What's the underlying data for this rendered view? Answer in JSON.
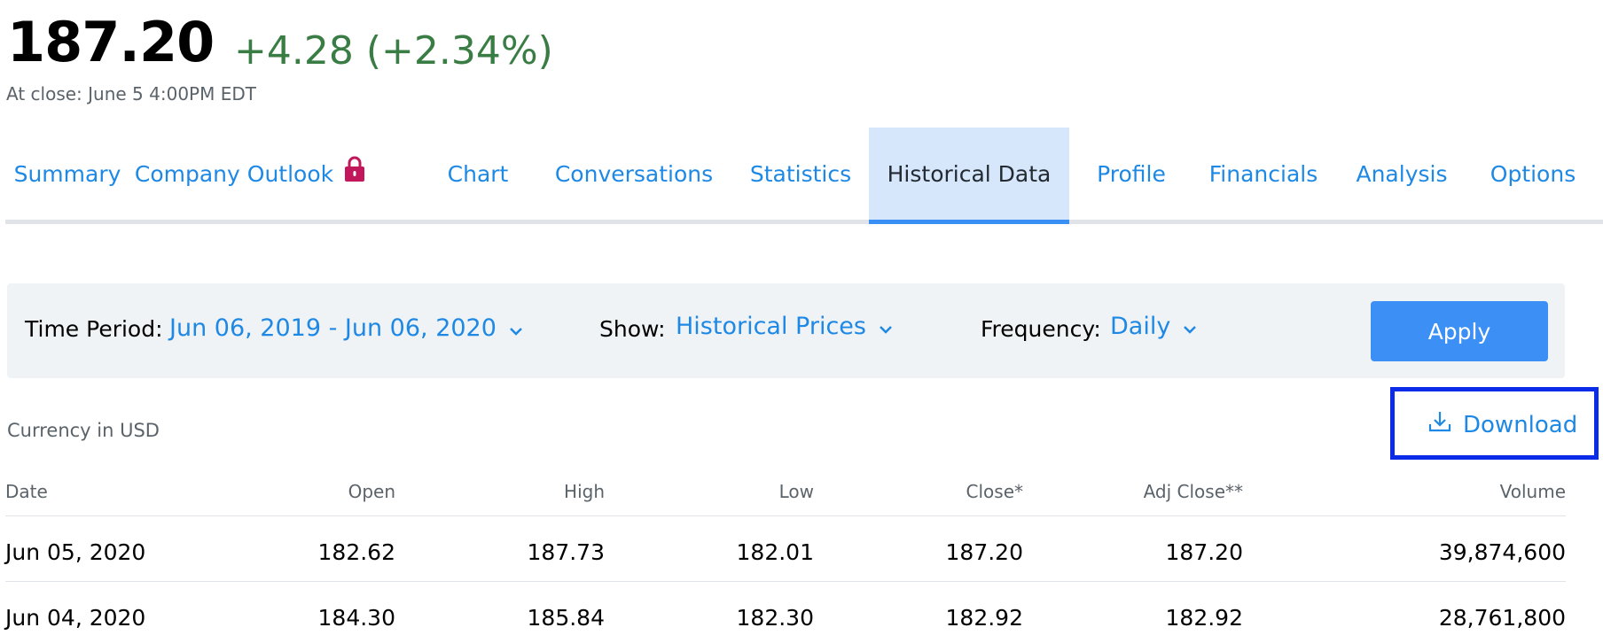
{
  "quote": {
    "price": "187.20",
    "change": "+4.28 (+2.34%)",
    "close_time": "At close: June 5 4:00PM EDT",
    "change_color": "#3a7d44"
  },
  "tabs": [
    {
      "label": "Summary"
    },
    {
      "label": "Company Outlook",
      "icon": "lock-icon"
    },
    {
      "label": "Chart"
    },
    {
      "label": "Conversations"
    },
    {
      "label": "Statistics"
    },
    {
      "label": "Historical Data",
      "active": true
    },
    {
      "label": "Profile"
    },
    {
      "label": "Financials"
    },
    {
      "label": "Analysis"
    },
    {
      "label": "Options"
    }
  ],
  "filters": {
    "time_period_label": "Time Period:",
    "time_period_value": "Jun 06, 2019 - Jun 06, 2020",
    "show_label": "Show:",
    "show_value": "Historical Prices",
    "frequency_label": "Frequency:",
    "frequency_value": "Daily",
    "apply_label": "Apply"
  },
  "currency_note": "Currency in USD",
  "download_label": "Download",
  "table": {
    "headers": [
      "Date",
      "Open",
      "High",
      "Low",
      "Close*",
      "Adj Close**",
      "Volume"
    ],
    "rows": [
      [
        "Jun 05, 2020",
        "182.62",
        "187.73",
        "182.01",
        "187.20",
        "187.20",
        "39,874,600"
      ],
      [
        "Jun 04, 2020",
        "184.30",
        "185.84",
        "182.30",
        "182.92",
        "182.92",
        "28,761,800"
      ]
    ]
  },
  "colors": {
    "accent": "#1e88e5",
    "apply_button": "#3c8ff4",
    "active_tab_bg": "#d6e6fb",
    "highlight_box": "#0a2ce8",
    "lock_icon": "#c2185b"
  }
}
